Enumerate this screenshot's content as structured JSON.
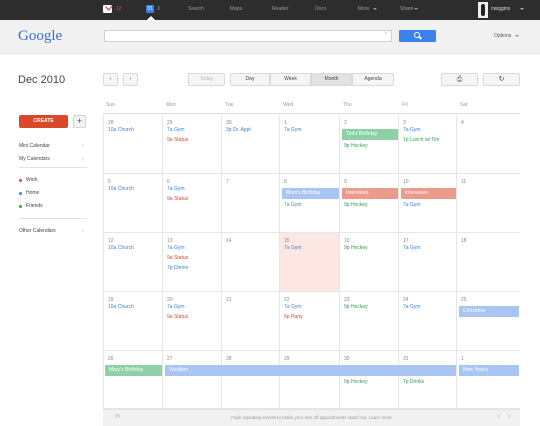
{
  "topbar": {
    "mail_count": "12",
    "calendar_badge": "31",
    "calendar_count": "3",
    "nav": [
      "Search",
      "Maps",
      "Reader",
      "Docs",
      "More",
      "Share"
    ],
    "user": "cwiggins"
  },
  "search": {
    "value": "",
    "clear": "×",
    "options_label": "Options"
  },
  "logo": "Google",
  "toolbar": {
    "month_label": "Dec 2010",
    "prev": "‹",
    "next": "›",
    "today": "Today",
    "day": "Day",
    "week": "Week",
    "month": "Month",
    "agenda": "Agenda",
    "print": "⎙",
    "refresh": "↻"
  },
  "sidebar": {
    "create_label": "CREATE",
    "plus_label": "+",
    "mini_calendar": "Mini Calendar",
    "my_calendars": "My Calendars",
    "calendars": [
      {
        "label": "Work",
        "color": "#e0533d"
      },
      {
        "label": "Home",
        "color": "#3b83e8"
      },
      {
        "label": "Friends",
        "color": "#2aa55a"
      }
    ],
    "other_calendars": "Other Calendars"
  },
  "colors": {
    "blue": "#3c82d8",
    "red": "#d24a3a",
    "green": "#2f9e4d",
    "bar_blue": "#a9c5f2",
    "bar_green": "#8fd1a6",
    "bar_red": "#ec9a8c",
    "today_bg": "#fce7e2"
  },
  "calendar": {
    "day_names": [
      "Sun",
      "Mon",
      "Tue",
      "Wed",
      "Thu",
      "Fri",
      "Sat"
    ],
    "today_index": 17,
    "cells": [
      {
        "day": "28",
        "events": [
          {
            "time": "10a",
            "title": "Church",
            "color": "blue"
          }
        ]
      },
      {
        "day": "29",
        "events": [
          {
            "time": "7a",
            "title": "Gym",
            "color": "blue"
          },
          {
            "time": "9a",
            "title": "Status",
            "color": "red"
          }
        ]
      },
      {
        "day": "30",
        "events": [
          {
            "time": "3p",
            "title": "Dr. Appt",
            "color": "blue"
          }
        ]
      },
      {
        "day": "1",
        "events": [
          {
            "time": "7a",
            "title": "Gym",
            "color": "blue"
          }
        ]
      },
      {
        "day": "2",
        "events": [
          {
            "time": "9p",
            "title": "Hockey",
            "color": "green"
          }
        ]
      },
      {
        "day": "3",
        "events": [
          {
            "time": "7a",
            "title": "Gym",
            "color": "blue"
          },
          {
            "time": "1p",
            "title": "Lunch w/ Tim",
            "color": "green"
          }
        ]
      },
      {
        "day": "4",
        "events": []
      },
      {
        "day": "5",
        "events": [
          {
            "time": "10a",
            "title": "Church",
            "color": "blue"
          }
        ]
      },
      {
        "day": "6",
        "events": [
          {
            "time": "7a",
            "title": "Gym",
            "color": "blue"
          },
          {
            "time": "9a",
            "title": "Status",
            "color": "red"
          }
        ]
      },
      {
        "day": "7",
        "events": []
      },
      {
        "day": "8",
        "events": [
          {
            "time": "7a",
            "title": "Gym",
            "color": "blue"
          }
        ]
      },
      {
        "day": "9",
        "events": [
          {
            "time": "9p",
            "title": "Hockey",
            "color": "green"
          }
        ]
      },
      {
        "day": "10",
        "events": [
          {
            "time": "7a",
            "title": "Gym",
            "color": "blue"
          }
        ]
      },
      {
        "day": "11",
        "events": []
      },
      {
        "day": "12",
        "events": [
          {
            "time": "10a",
            "title": "Church",
            "color": "blue"
          }
        ]
      },
      {
        "day": "13",
        "events": [
          {
            "time": "7a",
            "title": "Gym",
            "color": "blue"
          },
          {
            "time": "9a",
            "title": "Status",
            "color": "red"
          },
          {
            "time": "7p",
            "title": "Dinner",
            "color": "blue"
          }
        ]
      },
      {
        "day": "14",
        "events": []
      },
      {
        "day": "15",
        "events": [
          {
            "time": "7a",
            "title": "Gym",
            "color": "blue"
          }
        ]
      },
      {
        "day": "16",
        "events": [
          {
            "time": "9p",
            "title": "Hockey",
            "color": "green"
          }
        ]
      },
      {
        "day": "17",
        "events": [
          {
            "time": "7a",
            "title": "Gym",
            "color": "blue"
          }
        ]
      },
      {
        "day": "18",
        "events": []
      },
      {
        "day": "19",
        "events": [
          {
            "time": "10a",
            "title": "Church",
            "color": "blue"
          }
        ]
      },
      {
        "day": "20",
        "events": [
          {
            "time": "7a",
            "title": "Gym",
            "color": "blue"
          },
          {
            "time": "9a",
            "title": "Status",
            "color": "red"
          }
        ]
      },
      {
        "day": "21",
        "events": []
      },
      {
        "day": "22",
        "events": [
          {
            "time": "7a",
            "title": "Gym",
            "color": "blue"
          },
          {
            "time": "6p",
            "title": "Party",
            "color": "red"
          }
        ]
      },
      {
        "day": "23",
        "events": [
          {
            "time": "9p",
            "title": "Hockey",
            "color": "green"
          }
        ]
      },
      {
        "day": "24",
        "events": [
          {
            "time": "7a",
            "title": "Gym",
            "color": "blue"
          }
        ]
      },
      {
        "day": "25",
        "events": []
      },
      {
        "day": "26",
        "events": []
      },
      {
        "day": "27",
        "events": []
      },
      {
        "day": "28",
        "events": []
      },
      {
        "day": "29",
        "events": []
      },
      {
        "day": "30",
        "events": [
          {
            "time": "9p",
            "title": "Hockey",
            "color": "green"
          }
        ]
      },
      {
        "day": "31",
        "events": [
          {
            "time": "7p",
            "title": "Drinks",
            "color": "green"
          }
        ]
      },
      {
        "day": "1",
        "events": []
      }
    ],
    "bars": [
      {
        "title": "Tim's Birthday",
        "cell": 4,
        "span": 1,
        "color": "bar_green"
      },
      {
        "title": "Mom's Birthday",
        "cell": 10,
        "span": 1,
        "color": "bar_blue"
      },
      {
        "title": "Interviews",
        "cell": 11,
        "span": 1,
        "color": "bar_red"
      },
      {
        "title": "Interviews",
        "cell": 12,
        "span": 1,
        "color": "bar_red"
      },
      {
        "title": "Christmas",
        "cell": 27,
        "span": 1,
        "color": "bar_blue"
      },
      {
        "title": "Mary's Birthday",
        "cell": 28,
        "span": 1,
        "color": "bar_green"
      },
      {
        "title": "Vacation",
        "cell": 29,
        "span": 5,
        "color": "bar_blue"
      },
      {
        "title": "New Year's",
        "cell": 34,
        "span": 1,
        "color": "bar_blue"
      }
    ]
  },
  "footer": {
    "message": "Fade repeating events to make your one off appointments stand out. Learn more",
    "prev": "‹",
    "next": "›"
  }
}
